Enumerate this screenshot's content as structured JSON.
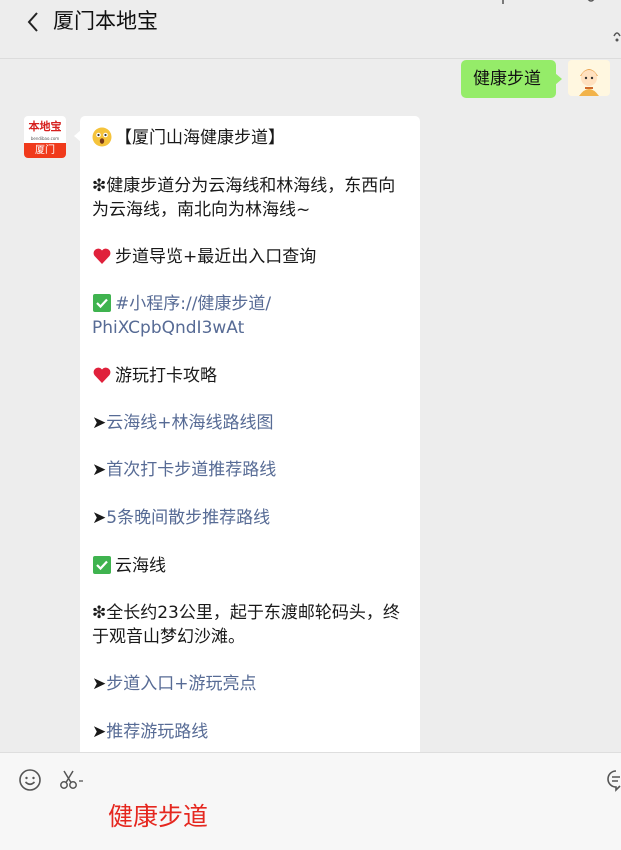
{
  "header": {
    "title": "厦门本地宝"
  },
  "messages": {
    "sent": {
      "text": "健康步道"
    },
    "received": {
      "avatar_top": "本地宝",
      "avatar_mid": "bendibao.com",
      "avatar_bottom": "厦门",
      "lines": {
        "l1": "【厦门山海健康步道】",
        "l2": "❇健康步道分为云海线和林海线，东西向",
        "l3": "为云海线，南北向为林海线~",
        "l4": "步道导览+最近出入口查询",
        "l5": "#小程序://健康步道/",
        "l6": "PhiXCpbQndI3wAt",
        "l7": "游玩打卡攻略",
        "l8a": "➤",
        "l8": "云海线+林海线路线图",
        "l9a": "➤",
        "l9": "首次打卡步道推荐路线",
        "l10a": "➤",
        "l10": "5条晚间散步推荐路线",
        "l11": "云海线",
        "l12": "❇全长约23公里，起于东渡邮轮码头，终",
        "l13": "于观音山梦幻沙滩。",
        "l14a": "➤",
        "l14": "步道入口+游玩亮点",
        "l15a": "➤",
        "l15": "推荐游玩路线"
      }
    }
  },
  "input": {
    "text": "健康步道"
  },
  "colors": {
    "background": "#ededed",
    "sent_bubble": "#95ec69",
    "link": "#576b95",
    "input_text": "#e5271f"
  }
}
